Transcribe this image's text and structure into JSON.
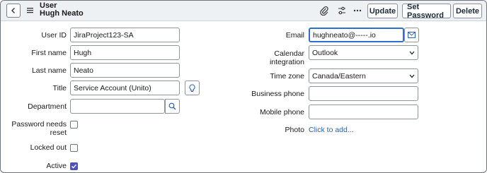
{
  "header": {
    "record_type": "User",
    "record_name": "Hugh Neato",
    "buttons": {
      "update": "Update",
      "set_password": "Set Password",
      "delete": "Delete"
    },
    "icons": [
      "back-icon",
      "hamburger-menu-icon",
      "paperclip-icon",
      "sliders-icon",
      "more-options-icon"
    ]
  },
  "form": {
    "left": {
      "user_id": {
        "label": "User ID",
        "value": "JiraProject123-SA"
      },
      "first_name": {
        "label": "First name",
        "value": "Hugh"
      },
      "last_name": {
        "label": "Last name",
        "value": "Neato"
      },
      "title": {
        "label": "Title",
        "value": "Service Account (Unito)"
      },
      "department": {
        "label": "Department",
        "value": ""
      },
      "password_needs_reset": {
        "label_line1": "Password needs",
        "label_line2": "reset",
        "checked": false
      },
      "locked_out": {
        "label": "Locked out",
        "checked": false
      },
      "active": {
        "label": "Active",
        "checked": true
      }
    },
    "right": {
      "email": {
        "label": "Email",
        "value": "hughneato@-----.io"
      },
      "calendar_integration": {
        "label_line1": "Calendar",
        "label_line2": "integration",
        "value": "Outlook"
      },
      "time_zone": {
        "label": "Time zone",
        "value": "Canada/Eastern"
      },
      "business_phone": {
        "label": "Business phone",
        "value": ""
      },
      "mobile_phone": {
        "label": "Mobile phone",
        "value": ""
      },
      "photo": {
        "label": "Photo",
        "link": "Click to add..."
      }
    }
  },
  "colors": {
    "header_bg": "#eef1f3",
    "focus_border": "#2f6fd0",
    "checkbox_checked": "#4f52bd",
    "link": "#2a62b8"
  }
}
